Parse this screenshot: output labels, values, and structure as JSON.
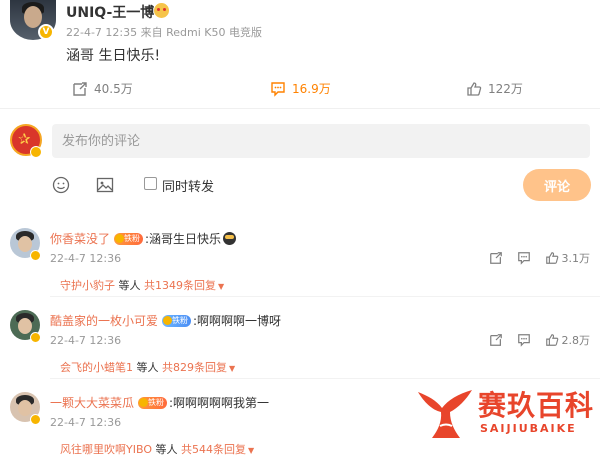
{
  "post": {
    "author": "UNIQ-王一博",
    "meta": "22-4-7 12:35  来自 Redmi K50 电竞版",
    "text": "涵哥 生日快乐!"
  },
  "actions": {
    "repost_count": "40.5万",
    "comment_count": "16.9万",
    "like_count": "122万"
  },
  "compose": {
    "placeholder": "发布你的评论",
    "repost_label": "同时转发",
    "submit_label": "评论"
  },
  "comments": [
    {
      "user": "你香菜没了",
      "badge": "铁粉",
      "text": ":涵哥生日快乐",
      "time": "22-4-7 12:36",
      "like_count": "3.1万",
      "replies_who": "守护小豹子",
      "replies_mid": " 等人 ",
      "replies_total": "共1349条回复"
    },
    {
      "user": "酷盖家的一枚小可爱",
      "badge": "铁粉",
      "text": ":啊啊啊啊一博呀",
      "time": "22-4-7 12:36",
      "like_count": "2.8万",
      "replies_who": "会飞的小蜡笔1",
      "replies_mid": " 等人 ",
      "replies_total": "共829条回复"
    },
    {
      "user": "一颗大大菜菜瓜",
      "badge": "铁粉",
      "text": ":啊啊啊啊啊我第一",
      "time": "22-4-7 12:36",
      "like_count": "",
      "replies_who": "风往哪里吹啊YIBO",
      "replies_mid": " 等人 ",
      "replies_total": "共544条回复"
    }
  ],
  "watermark": {
    "title": "赛玖百科",
    "subtitle": "SAIJIUBAIKE"
  },
  "colors": {
    "accent": "#ff8200",
    "username": "#eb7350",
    "submit": "#ffc38a",
    "watermark": "#e8452b"
  }
}
